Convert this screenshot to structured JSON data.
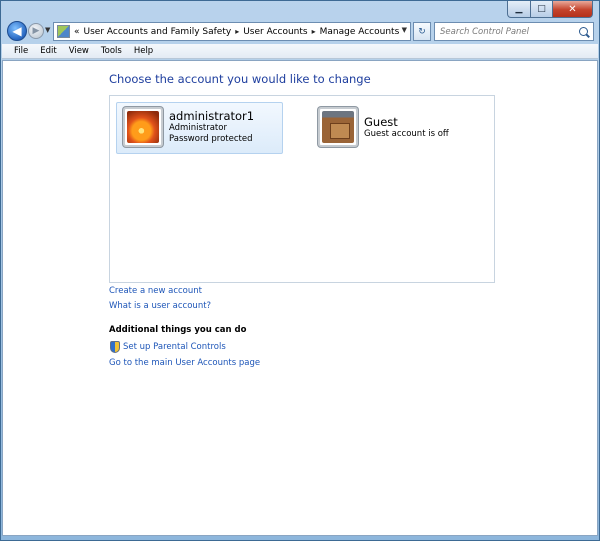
{
  "titlebar": {
    "minimize_glyph": "▁",
    "maximize_glyph": "□",
    "close_glyph": "✕"
  },
  "nav": {
    "back_glyph": "◀",
    "forward_glyph": "▶",
    "overflow_glyph": "«",
    "breadcrumb": [
      "User Accounts and Family Safety",
      "User Accounts",
      "Manage Accounts"
    ],
    "separator": "▸",
    "refresh_glyph": "↻",
    "search_placeholder": "Search Control Panel"
  },
  "menu": [
    "File",
    "Edit",
    "View",
    "Tools",
    "Help"
  ],
  "main": {
    "heading": "Choose the account you would like to change",
    "accounts": [
      {
        "name": "administrator1",
        "type": "Administrator",
        "status": "Password protected",
        "picture": "flower"
      },
      {
        "name": "Guest",
        "status": "Guest account is off",
        "picture": "briefcase"
      }
    ],
    "links": {
      "create": "Create a new account",
      "what_is": "What is a user account?"
    },
    "additional_heading": "Additional things you can do",
    "parental_controls": "Set up Parental Controls",
    "main_page": "Go to the main User Accounts page"
  },
  "colors": {
    "link": "#1e56b8",
    "heading": "#1e3e9e",
    "frame": "#b9d3ec"
  }
}
